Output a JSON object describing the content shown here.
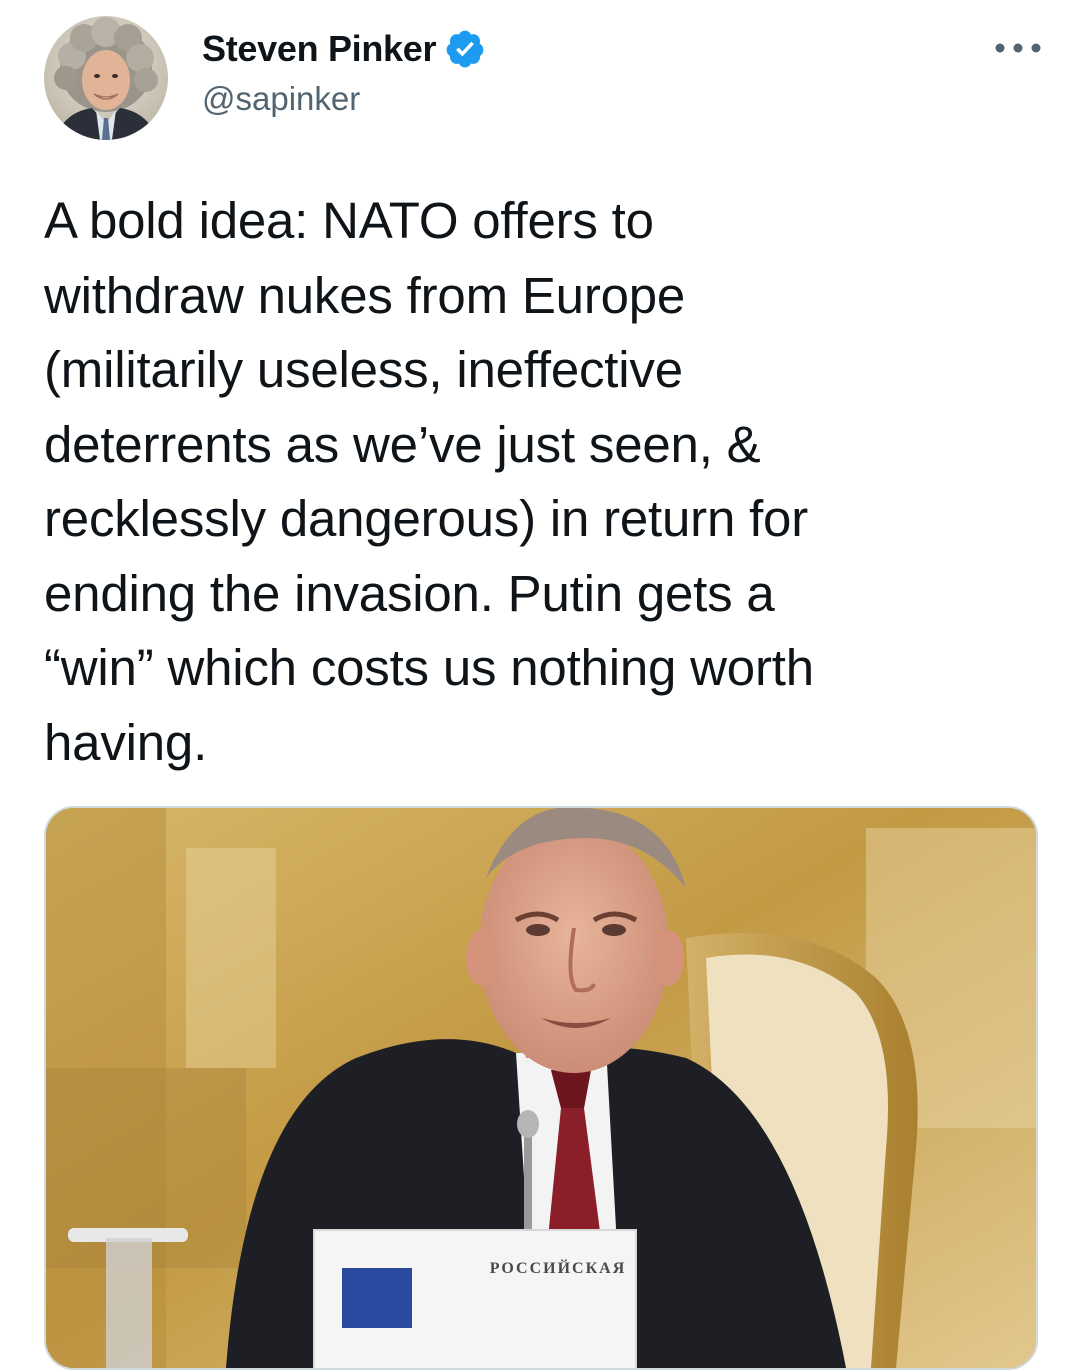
{
  "author": {
    "display_name": "Steven Pinker",
    "handle": "@sapinker",
    "verified": true,
    "avatar_icon": "avatar-photo",
    "verified_icon": "verified-badge-icon"
  },
  "menu": {
    "icon": "more-options-icon",
    "label": "•••"
  },
  "tweet": {
    "text": "A bold idea: NATO offers to\nwithdraw nukes from Europe\n(militarily useless, ineffective\ndeterrents as we’ve just seen, &\nrecklessly dangerous) in return for\nending the invasion. Putin gets a\n“win” which costs us nothing worth\nhaving."
  },
  "media": {
    "nameplate_text": "РОССИЙСКАЯ"
  },
  "colors": {
    "verified_blue": "#1d9bf0",
    "secondary_text": "#536471",
    "primary_text": "#0f1419",
    "border": "#cfd9de"
  }
}
